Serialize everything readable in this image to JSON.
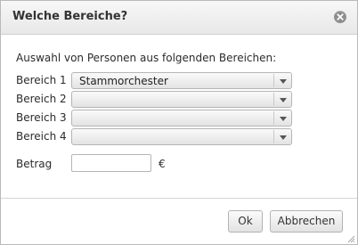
{
  "dialog": {
    "title": "Welche Bereiche?",
    "close_icon": "close-icon",
    "intro": "Auswahl von Personen aus folgenden Bereichen:",
    "rows": [
      {
        "label": "Bereich 1",
        "value": "Stammorchester"
      },
      {
        "label": "Bereich 2",
        "value": ""
      },
      {
        "label": "Bereich 3",
        "value": ""
      },
      {
        "label": "Bereich 4",
        "value": ""
      }
    ],
    "amount": {
      "label": "Betrag",
      "value": "",
      "currency": "€"
    },
    "buttons": {
      "ok": "Ok",
      "cancel": "Abbrechen"
    }
  }
}
